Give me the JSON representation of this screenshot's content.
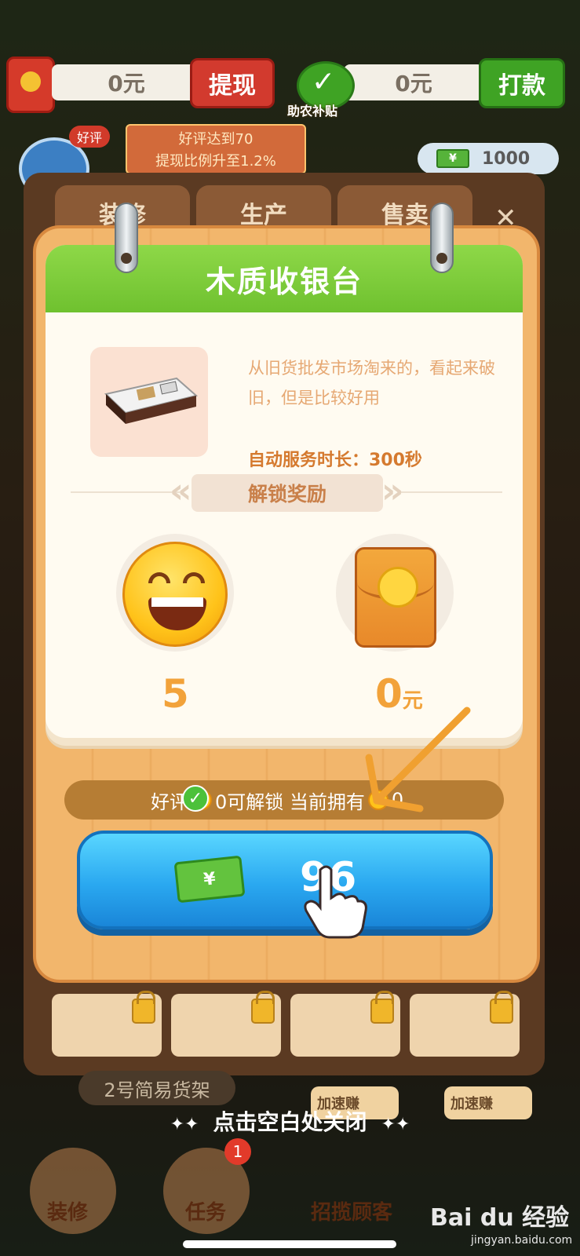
{
  "hud": {
    "balance_value": "0元",
    "withdraw_label": "提现",
    "subsidy_value": "0元",
    "pay_label": "打款",
    "subsidy_label": "助农补贴",
    "good_review_badge": "好评",
    "promo_line1": "好评达到70",
    "promo_line2": "提现比例升至1.2%",
    "cash_amount": "1000",
    "cash_symbol": "¥"
  },
  "tabs": [
    "装修",
    "生产",
    "售卖"
  ],
  "dialog": {
    "title": "木质收银台",
    "description": "从旧货批发市场淘来的，看起来破旧，但是比较好用",
    "auto_service": "自动服务时长：300秒",
    "unlock_reward_label": "解锁奖励",
    "rewards": {
      "smile_value": "5",
      "cash_value": "0",
      "cash_unit": "元"
    },
    "condition": {
      "part1": "好评",
      "part2": "0可解锁 当前拥有",
      "part3": "0"
    },
    "buy_price": "96",
    "money_symbol": "¥"
  },
  "bottom": {
    "shelf_label": "2号简易货架",
    "speed_label": "加速赚",
    "close_hint": "点击空白处关闭",
    "nav_labels": [
      "装修",
      "任务",
      "招揽顾客"
    ],
    "task_badge": "1",
    "watermark": "Bai du 经验",
    "watermark_sub": "jingyan.baidu.com"
  },
  "colors": {
    "header_green": "#6fc12f",
    "button_blue": "#2aa8f0",
    "reward_orange": "#f2a23a",
    "withdraw_red": "#d23a2e",
    "pay_green": "#3fa324"
  },
  "icons": [
    "red-packet-icon",
    "check-icon",
    "smile-face-icon",
    "cash-icon",
    "lock-icon",
    "tap-hand-icon",
    "arrow-icon",
    "close-icon"
  ]
}
